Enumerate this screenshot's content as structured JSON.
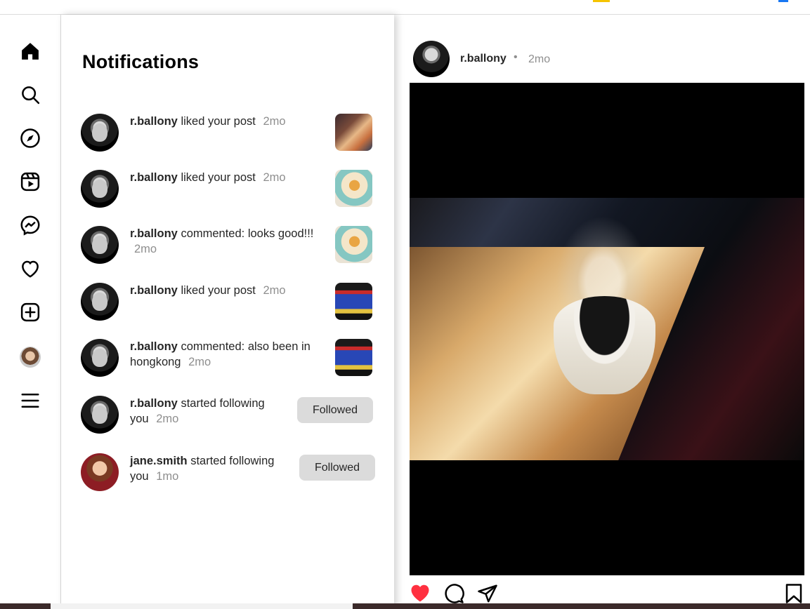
{
  "notifications": {
    "title": "Notifications",
    "items": [
      {
        "user": "r.ballony",
        "action": "liked your post",
        "time": "2mo",
        "thumb": "food-platter"
      },
      {
        "user": "r.ballony",
        "action": "liked your post",
        "time": "2mo",
        "thumb": "burger-plate"
      },
      {
        "user": "r.ballony",
        "action": "commented: looks good!!!",
        "time": "2mo",
        "thumb": "burger-plate"
      },
      {
        "user": "r.ballony",
        "action": "liked your post",
        "time": "2mo",
        "thumb": "tuk-tuk"
      },
      {
        "user": "r.ballony",
        "action": "commented: also been in hongkong",
        "time": "2mo",
        "thumb": "tuk-tuk"
      },
      {
        "user": "r.ballony",
        "action": "started following you",
        "time": "2mo",
        "button": "Followed"
      },
      {
        "user": "jane.smith",
        "action": "started following you",
        "time": "1mo",
        "button": "Followed"
      }
    ]
  },
  "post": {
    "user": "r.ballony",
    "separator": "•",
    "time": "2mo",
    "liked": true
  },
  "sidebar": {
    "icons": [
      "home-icon",
      "search-icon",
      "explore-icon",
      "reels-icon",
      "messenger-icon",
      "heart-icon",
      "create-icon",
      "profile-avatar",
      "menu-icon"
    ]
  },
  "colors": {
    "like_red": "#ff3040",
    "button_gray": "#dbdbdb",
    "muted_text": "#8e8e8e"
  }
}
